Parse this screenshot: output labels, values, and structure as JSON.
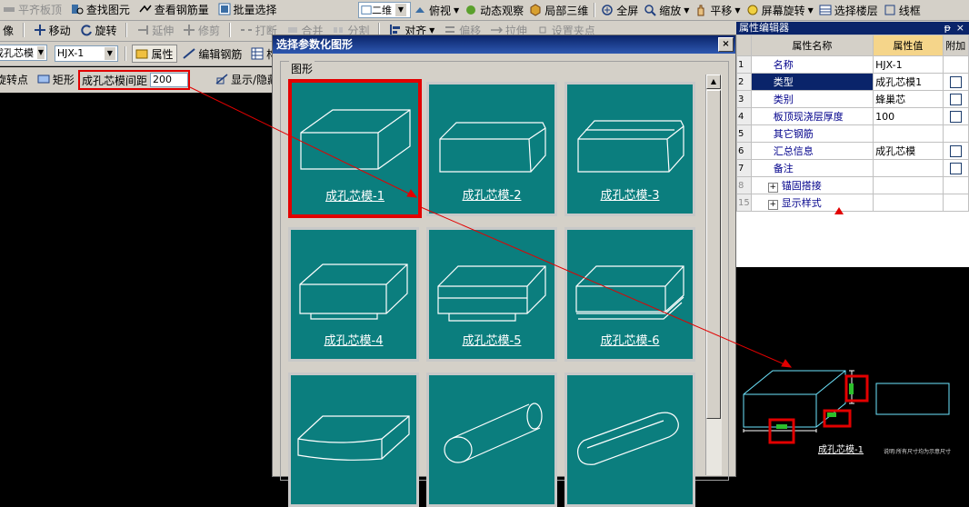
{
  "toolbar1": {
    "items": [
      {
        "label": "平齐板顶",
        "icon": "flush-slab-icon",
        "disabled": true
      },
      {
        "label": "查找图元",
        "icon": "find-element-icon"
      },
      {
        "label": "查看钢筋量",
        "icon": "view-rebar-icon"
      },
      {
        "label": "批量选择",
        "icon": "batch-select-icon"
      }
    ],
    "view_mode": "二维",
    "view_items": [
      {
        "label": "俯视",
        "icon": "top-view-icon"
      },
      {
        "label": "动态观察",
        "icon": "dynamic-view-icon"
      },
      {
        "label": "局部三维",
        "icon": "local-3d-icon"
      },
      {
        "label": "全屏",
        "icon": "fullscreen-icon"
      },
      {
        "label": "缩放",
        "icon": "zoom-icon"
      },
      {
        "label": "平移",
        "icon": "pan-icon"
      },
      {
        "label": "屏幕旋转",
        "icon": "screen-rotate-icon"
      },
      {
        "label": "选择楼层",
        "icon": "select-floor-icon"
      },
      {
        "label": "线框",
        "icon": "wireframe-icon"
      }
    ]
  },
  "toolbar2": {
    "mirror": "像",
    "move": "移动",
    "rotate": "旋转",
    "extend": "延伸",
    "trim": "修剪",
    "break": "打断",
    "merge": "合并",
    "split": "分割",
    "align": "对齐",
    "offset": "偏移",
    "stretch": "拉伸",
    "set_point": "设置夹点"
  },
  "toolbar3": {
    "category_value": "成孔芯模",
    "element_value": "HJX-1",
    "property": "属性",
    "edit_rebar": "编辑钢筋",
    "component_list": "构"
  },
  "toolbar4": {
    "rotate_point": "旋转点",
    "rectangle": "矩形",
    "spacing_label": "成孔芯模间距",
    "spacing_value": "200",
    "show_hide": "显示/隐藏"
  },
  "dialog": {
    "title": "选择参数化图形",
    "close": "×",
    "group": "图形",
    "tiles": [
      {
        "label": "成孔芯模-1",
        "shape": "box-bevel-top",
        "selected": true
      },
      {
        "label": "成孔芯模-2",
        "shape": "box-bevel-all"
      },
      {
        "label": "成孔芯模-3",
        "shape": "box-bevel-high"
      },
      {
        "label": "成孔芯模-4",
        "shape": "box-flange"
      },
      {
        "label": "成孔芯模-5",
        "shape": "box-flange-2"
      },
      {
        "label": "成孔芯模-6",
        "shape": "box-flange-3"
      },
      {
        "label": "",
        "shape": "box-curved"
      },
      {
        "label": "",
        "shape": "cylinder"
      },
      {
        "label": "",
        "shape": "round-bar"
      }
    ]
  },
  "property_editor": {
    "title": "属性编辑器",
    "pin": "ᵽ",
    "close": "×",
    "headers": {
      "name": "属性名称",
      "value": "属性值",
      "extra": "附加"
    },
    "rows": [
      {
        "num": "1",
        "name": "名称",
        "value": "HJX-1",
        "checkbox": false
      },
      {
        "num": "2",
        "name": "类型",
        "value": "成孔芯模1",
        "checkbox": true,
        "selected": true
      },
      {
        "num": "3",
        "name": "类别",
        "value": "蜂巢芯",
        "checkbox": true
      },
      {
        "num": "4",
        "name": "板顶现浇层厚度",
        "value": "100",
        "checkbox": true
      },
      {
        "num": "5",
        "name": "其它钢筋",
        "value": "",
        "checkbox": false
      },
      {
        "num": "6",
        "name": "汇总信息",
        "value": "成孔芯模",
        "checkbox": true
      },
      {
        "num": "7",
        "name": "备注",
        "value": "",
        "checkbox": true
      },
      {
        "num": "8",
        "name": "锚固搭接",
        "value": "",
        "checkbox": false,
        "expand": true,
        "dim": true
      },
      {
        "num": "15",
        "name": "显示样式",
        "value": "",
        "checkbox": false,
        "expand": true,
        "dim": true
      }
    ]
  },
  "preview": {
    "label": "成孔芯模-1",
    "note": "说明:所有尺寸均为示意尺寸"
  },
  "colors": {
    "tile_bg": "#0b7e7e",
    "highlight_red": "#e20000",
    "cad_cyan": "#6ee6ff",
    "cad_background": "#000000",
    "title_bar": "#0a246a"
  }
}
